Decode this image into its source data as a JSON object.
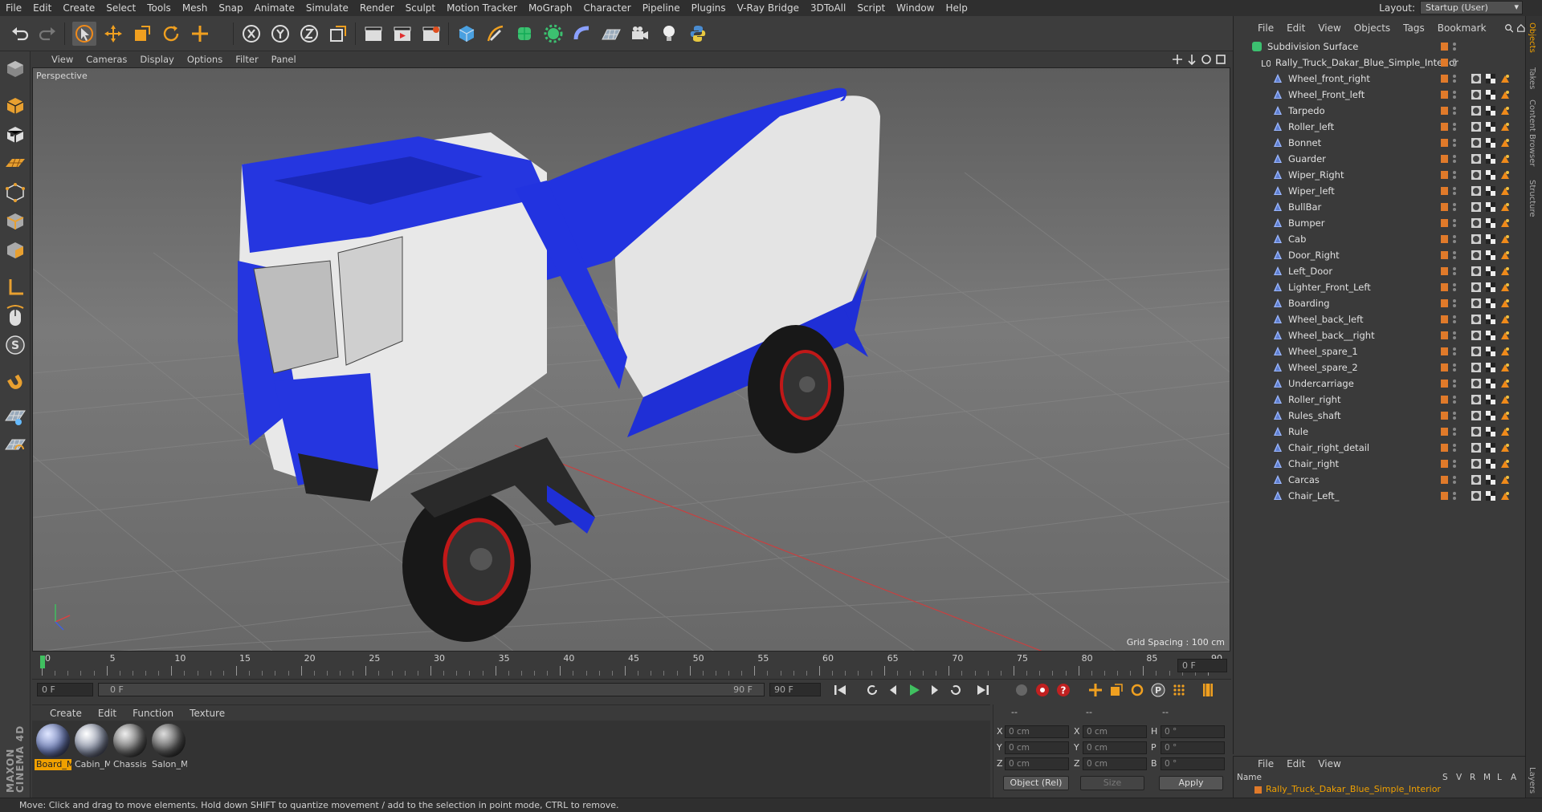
{
  "menu": [
    "File",
    "Edit",
    "Create",
    "Select",
    "Tools",
    "Mesh",
    "Snap",
    "Animate",
    "Simulate",
    "Render",
    "Sculpt",
    "Motion Tracker",
    "MoGraph",
    "Character",
    "Pipeline",
    "Plugins",
    "V-Ray Bridge",
    "3DToAll",
    "Script",
    "Window",
    "Help"
  ],
  "layout": {
    "label": "Layout:",
    "value": "Startup (User)"
  },
  "viewport": {
    "menu": [
      "View",
      "Cameras",
      "Display",
      "Options",
      "Filter",
      "Panel"
    ],
    "label": "Perspective",
    "grid_spacing": "Grid Spacing : 100 cm"
  },
  "timeline": {
    "ticks": [
      "0",
      "5",
      "10",
      "15",
      "20",
      "25",
      "30",
      "35",
      "40",
      "45",
      "50",
      "55",
      "60",
      "65",
      "70",
      "75",
      "80",
      "85",
      "90"
    ],
    "current_frame_field": "0 F",
    "start_field": "0 F",
    "range_start": "0 F",
    "range_end": "90 F",
    "end_field": "90 F",
    "end_field2": "0 F"
  },
  "materials": {
    "menu": [
      "Create",
      "Edit",
      "Function",
      "Texture"
    ],
    "items": [
      {
        "label": "Board_M",
        "color": "#6f7fb8"
      },
      {
        "label": "Cabin_M",
        "color": "#8e96ab"
      },
      {
        "label": "Chassis",
        "color": "#6e6e6e"
      },
      {
        "label": "Salon_M",
        "color": "#5a5a5a"
      }
    ]
  },
  "coords": {
    "headers": [
      "--",
      "--",
      "--"
    ],
    "rows": [
      {
        "a": "X",
        "av": "0 cm",
        "b": "X",
        "bv": "0 cm",
        "c": "H",
        "cv": "0 °"
      },
      {
        "a": "Y",
        "av": "0 cm",
        "b": "Y",
        "bv": "0 cm",
        "c": "P",
        "cv": "0 °"
      },
      {
        "a": "Z",
        "av": "0 cm",
        "b": "Z",
        "bv": "0 cm",
        "c": "B",
        "cv": "0 °"
      }
    ],
    "mode": "Object (Rel)",
    "size": "Size",
    "apply": "Apply"
  },
  "status": "Move: Click and drag to move elements. Hold down SHIFT to quantize movement / add to the selection in point mode, CTRL to remove.",
  "objects": {
    "menu": [
      "File",
      "Edit",
      "View",
      "Objects",
      "Tags",
      "Bookmark"
    ],
    "root": "Subdivision Surface",
    "group": "Rally_Truck_Dakar_Blue_Simple_Interior",
    "children": [
      "Wheel_front_right",
      "Wheel_Front_left",
      "Tarpedo",
      "Roller_left",
      "Bonnet",
      "Guarder",
      "Wiper_Right",
      "Wiper_left",
      "BullBar",
      "Bumper",
      "Cab",
      "Door_Right",
      "Left_Door",
      "Lighter_Front_Left",
      "Boarding",
      "Wheel_back_left",
      "Wheel_back__right",
      "Wheel_spare_1",
      "Wheel_spare_2",
      "Undercarriage",
      "Roller_right",
      "Rules_shaft",
      "Rule",
      "Chair_right_detail",
      "Chair_right",
      "Carcas",
      "Chair_Left_"
    ]
  },
  "layers": {
    "menu": [
      "File",
      "Edit",
      "View"
    ],
    "columns": [
      "Name",
      "S",
      "V",
      "R",
      "M",
      "L",
      "A"
    ],
    "item": "Rally_Truck_Dakar_Blue_Simple_Interior"
  },
  "right_tabs": [
    "Objects",
    "Takes",
    "Content Browser",
    "Structure",
    "Layers"
  ],
  "maxon": "MAXON CINEMA 4D",
  "colors": {
    "accent": "#f0a000",
    "object_blue": "#1f2fd6",
    "truck_white": "#e8e8e8"
  }
}
